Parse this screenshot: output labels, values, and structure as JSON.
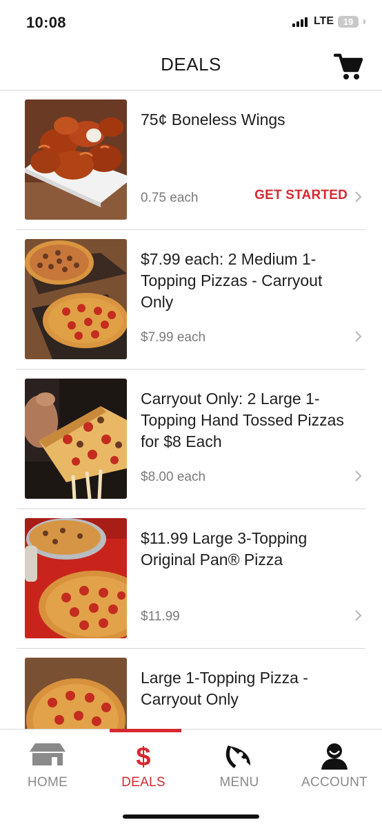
{
  "status_bar": {
    "time": "10:08",
    "network": "LTE",
    "battery": "19"
  },
  "header": {
    "title": "DEALS",
    "cart_icon": "cart-icon"
  },
  "deals": [
    {
      "title": "75¢ Boneless Wings",
      "price": "0.75 each",
      "cta": "GET STARTED",
      "image": "boneless-wings-image"
    },
    {
      "title": "$7.99 each: 2 Medium 1-Topping Pizzas - Carryout Only",
      "price": "$7.99 each",
      "cta": "",
      "image": "two-medium-pizzas-image"
    },
    {
      "title": "Carryout Only: 2 Large 1-Topping Hand Tossed Pizzas for $8 Each",
      "price": "$8.00 each",
      "cta": "",
      "image": "hand-tossed-pizza-slice-image"
    },
    {
      "title": "$11.99 Large 3-Topping Original Pan® Pizza",
      "price": "$11.99",
      "cta": "",
      "image": "pan-pizza-image"
    },
    {
      "title": "Large 1-Topping Pizza - Carryout Only",
      "price": "",
      "cta": "",
      "image": "pepperoni-pizza-image"
    }
  ],
  "tabs": [
    {
      "label": "HOME",
      "icon": "home-icon",
      "active": false
    },
    {
      "label": "DEALS",
      "icon": "dollar-icon",
      "active": true
    },
    {
      "label": "MENU",
      "icon": "pizza-slice-icon",
      "active": false
    },
    {
      "label": "ACCOUNT",
      "icon": "user-icon",
      "active": false
    }
  ],
  "colors": {
    "accent": "#d7282f",
    "muted_text": "#7a7a7a",
    "divider": "#d6d6d6"
  }
}
